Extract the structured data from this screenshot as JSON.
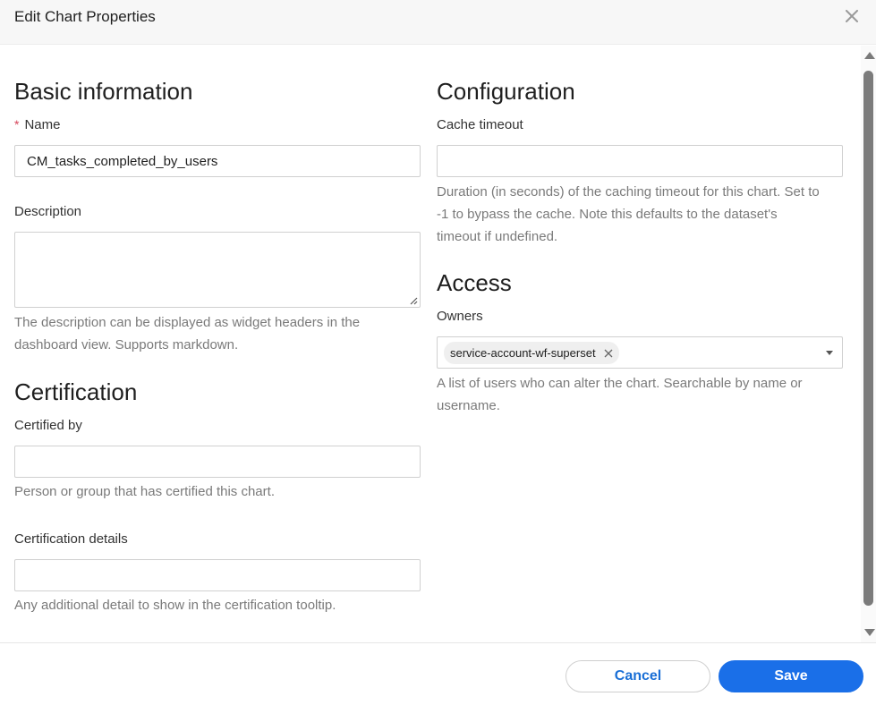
{
  "header": {
    "title": "Edit Chart Properties"
  },
  "basic": {
    "title": "Basic information",
    "name_label": "Name",
    "name_required_mark": "*",
    "name_value": "CM_tasks_completed_by_users",
    "description_label": "Description",
    "description_value": "",
    "description_help_line1": "The description can be displayed as widget headers in the",
    "description_help_line2": "dashboard view. Supports markdown."
  },
  "certification": {
    "title": "Certification",
    "certified_by_label": "Certified by",
    "certified_by_value": "",
    "certified_by_help": "Person or group that has certified this chart.",
    "details_label": "Certification details",
    "details_value": "",
    "details_help": "Any additional detail to show in the certification tooltip."
  },
  "configuration": {
    "title": "Configuration",
    "cache_label": "Cache timeout",
    "cache_value": "",
    "cache_help_line1": "Duration (in seconds) of the caching timeout for this chart. Set to",
    "cache_help_line2": "-1 to bypass the cache. Note this defaults to the dataset's",
    "cache_help_line3": "timeout if undefined."
  },
  "access": {
    "title": "Access",
    "owners_label": "Owners",
    "owners": [
      "service-account-wf-superset"
    ],
    "owners_help_line1": "A list of users who can alter the chart. Searchable by name or",
    "owners_help_line2": "username."
  },
  "footer": {
    "cancel_label": "Cancel",
    "save_label": "Save"
  },
  "colors": {
    "primary": "#1a6fe8",
    "required": "#d6455a",
    "help_text": "#7a7a7a"
  },
  "icons": {
    "close": "close-icon",
    "tag_remove": "close-icon",
    "dropdown": "chevron-down-icon"
  }
}
